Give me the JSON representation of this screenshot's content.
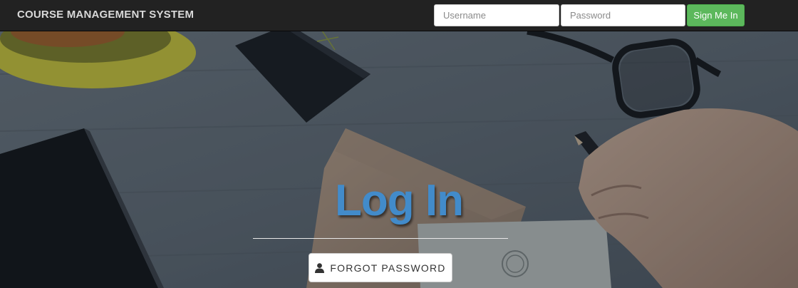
{
  "navbar": {
    "brand": "COURSE MANAGEMENT SYSTEM",
    "username_placeholder": "Username",
    "password_placeholder": "Password",
    "signin_label": "Sign Me In"
  },
  "hero": {
    "title": "Log In",
    "forgot_label": "FORGOT PASSWORD",
    "forgot_icon": "user-icon"
  },
  "colors": {
    "navbar_bg": "#222222",
    "brand_text": "#d9d9d9",
    "signin_bg": "#5cb85c",
    "title": "#428bca"
  }
}
